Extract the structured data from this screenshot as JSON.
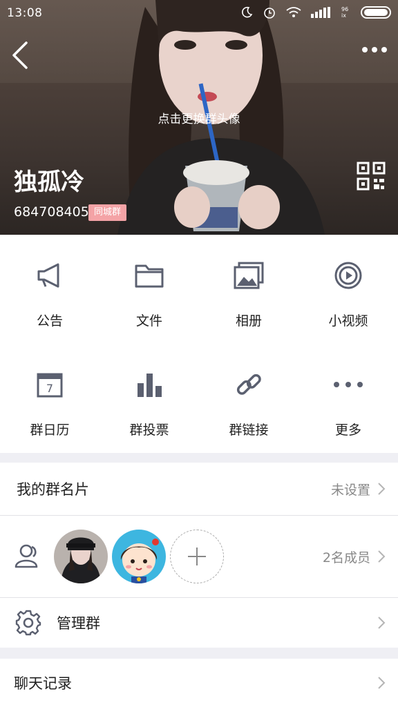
{
  "status": {
    "time": "13:08",
    "signal_label": "4G",
    "carrier_small": "96 ix"
  },
  "header": {
    "change_avatar_hint": "点击更换群头像",
    "group_name": "独孤冷",
    "group_id": "684708405",
    "tag": "同城群"
  },
  "features": [
    {
      "label": "公告",
      "icon": "megaphone-icon"
    },
    {
      "label": "文件",
      "icon": "folder-icon"
    },
    {
      "label": "相册",
      "icon": "album-icon"
    },
    {
      "label": "小视频",
      "icon": "video-icon"
    },
    {
      "label": "群日历",
      "icon": "calendar-icon"
    },
    {
      "label": "群投票",
      "icon": "poll-icon"
    },
    {
      "label": "群链接",
      "icon": "link-icon"
    },
    {
      "label": "更多",
      "icon": "more-icon"
    }
  ],
  "my_card": {
    "label": "我的群名片",
    "value": "未设置"
  },
  "members": {
    "count_text": "2名成员"
  },
  "manage": {
    "label": "管理群"
  },
  "chat_history": {
    "label": "聊天记录"
  },
  "calendar_day": "7",
  "colors": {
    "icon_gray": "#5b6070",
    "tag_pink": "#f4a3a6",
    "background": "#efeff4"
  }
}
